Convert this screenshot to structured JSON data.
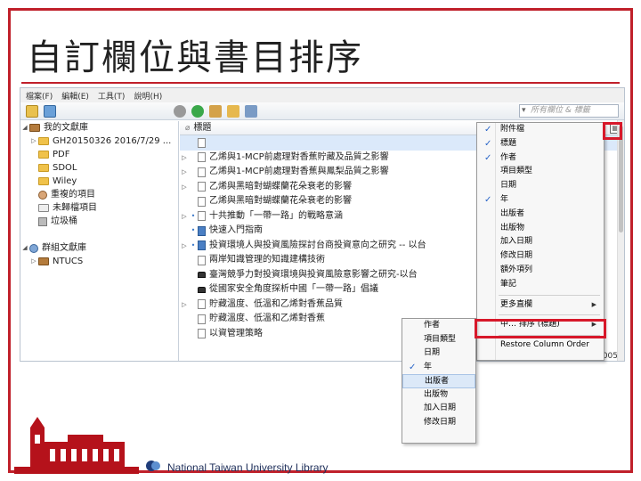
{
  "slide": {
    "title": "自訂欄位與書目排序"
  },
  "menubar": [
    "檔案(F)",
    "編輯(E)",
    "工具(T)",
    "說明(H)"
  ],
  "search": {
    "placeholder": "所有欄位 & 標籤"
  },
  "tree": [
    {
      "label": "我的文獻庫",
      "icon": "library-icon",
      "toggle": "◢"
    },
    {
      "label": "GH20150326 2016/7/29 ...",
      "icon": "folder-icon",
      "toggle": "▷"
    },
    {
      "label": "PDF",
      "icon": "folder-icon",
      "toggle": ""
    },
    {
      "label": "SDOL",
      "icon": "folder-icon",
      "toggle": ""
    },
    {
      "label": "Wiley",
      "icon": "folder-icon",
      "toggle": ""
    },
    {
      "label": "重複的項目",
      "icon": "duplicate-icon",
      "toggle": ""
    },
    {
      "label": "未歸檔項目",
      "icon": "unfiled-icon",
      "toggle": ""
    },
    {
      "label": "垃圾桶",
      "icon": "trash-icon",
      "toggle": ""
    },
    {
      "label": "",
      "icon": "",
      "toggle": ""
    },
    {
      "label": "群組文獻庫",
      "icon": "group-library-icon",
      "toggle": "◢"
    },
    {
      "label": "NTUCS",
      "icon": "library-icon",
      "toggle": "▷"
    }
  ],
  "items_header": {
    "title_col": "標題"
  },
  "items": [
    {
      "title": "",
      "tog": "",
      "dot": "",
      "icon": "doc"
    },
    {
      "title": "乙烯與1-MCP前處理對香蕉貯藏及品質之影響",
      "tog": "▷",
      "dot": "",
      "icon": "doc"
    },
    {
      "title": "乙烯與1-MCP前處理對香蕉與鳳梨品質之影響",
      "tog": "▷",
      "dot": "",
      "icon": "doc"
    },
    {
      "title": "乙烯與黑暗對蝴蝶蘭花朵衰老的影響",
      "tog": "▷",
      "dot": "",
      "icon": "doc"
    },
    {
      "title": "乙烯與黑暗對蝴蝶蘭花朵衰老的影響",
      "tog": "",
      "dot": "",
      "icon": "doc"
    },
    {
      "title": "十共推動「一帶一路」的戰略意涵",
      "tog": "▷",
      "dot": "•",
      "icon": "doc"
    },
    {
      "title": "快速入門指南",
      "tog": "",
      "dot": "•",
      "icon": "book"
    },
    {
      "title": "投資環境人與投資風險探討台商投資意向之研究 -- 以台",
      "tog": "▷",
      "dot": "•",
      "icon": "book"
    },
    {
      "title": "兩岸知識管理的知識建構技術",
      "tog": "",
      "dot": "",
      "icon": "doc"
    },
    {
      "title": "臺灣競爭力對投資環境與投資風險意影響之研究-以台",
      "tog": "",
      "dot": "",
      "icon": "hat"
    },
    {
      "title": "從國家安全角度探析中國「一帶一路」倡議",
      "tog": "",
      "dot": "",
      "icon": "hat"
    },
    {
      "title": "貯藏溫度、低溫和乙烯對香蕉品質",
      "tog": "▷",
      "dot": "",
      "icon": "doc"
    },
    {
      "title": "貯藏溫度、低溫和乙烯對香蕉",
      "tog": "",
      "dot": "",
      "icon": "doc"
    },
    {
      "title": "以資管理策略",
      "tog": "",
      "dot": "",
      "icon": "doc"
    }
  ],
  "date_tail": "2005",
  "context_menu": {
    "items": [
      {
        "label": "附件檔",
        "checked": true
      },
      {
        "label": "標題",
        "checked": true
      },
      {
        "label": "作者",
        "checked": true
      },
      {
        "label": "項目類型",
        "checked": false
      },
      {
        "label": "日期",
        "checked": false
      },
      {
        "label": "年",
        "checked": true
      },
      {
        "label": "出版者",
        "checked": false
      },
      {
        "label": "出版物",
        "checked": false
      },
      {
        "label": "加入日期",
        "checked": false
      },
      {
        "label": "修改日期",
        "checked": false
      },
      {
        "label": "額外項列",
        "checked": false
      },
      {
        "label": "筆記",
        "checked": false
      }
    ],
    "more_columns": "更多直欄",
    "sort_by": "中… 排序 (標題)",
    "restore": "Restore Column Order"
  },
  "sort_submenu": [
    {
      "label": "作者",
      "checked": false
    },
    {
      "label": "項目類型",
      "checked": false
    },
    {
      "label": "日期",
      "checked": false
    },
    {
      "label": "年",
      "checked": true
    },
    {
      "label": "出版者",
      "checked": false,
      "highlighted": true
    },
    {
      "label": "出版物",
      "checked": false
    },
    {
      "label": "加入日期",
      "checked": false
    },
    {
      "label": "修改日期",
      "checked": false
    }
  ],
  "footer": {
    "library_name": "National Taiwan University Library"
  },
  "colors": {
    "accent": "#c0202a",
    "highlight_box": "#d7182a",
    "check": "#2b66c8",
    "selection": "#dbe9fa"
  }
}
